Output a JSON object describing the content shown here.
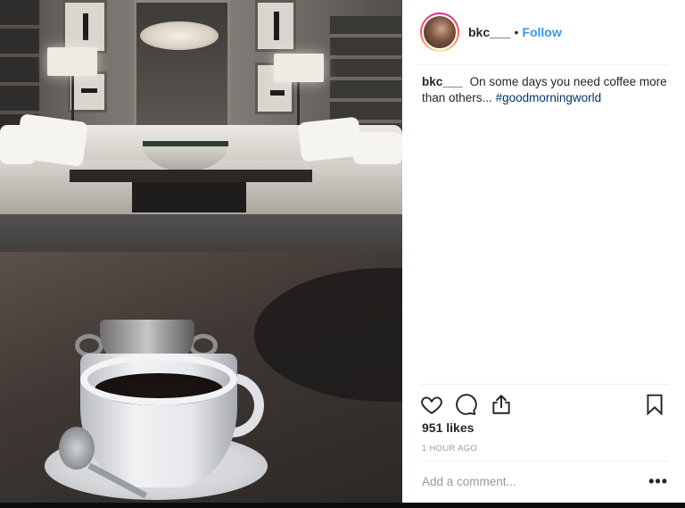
{
  "post": {
    "author": {
      "username": "bkc___"
    },
    "follow_label": "Follow",
    "separator": "•",
    "caption": {
      "username": "bkc___",
      "text": "On some days you need coffee more than others...",
      "hashtag": "#goodmorningworld"
    },
    "likes": "951 likes",
    "timestamp": "1 HOUR AGO",
    "comment": {
      "placeholder": "Add a comment...",
      "value": ""
    },
    "more_label": "•••"
  },
  "colors": {
    "link_blue": "#3897f0",
    "hashtag": "#003569",
    "muted": "#999999"
  },
  "icons": {
    "like": "heart-outline",
    "comment": "speech-bubble",
    "share": "share-upload",
    "save": "bookmark-outline"
  }
}
